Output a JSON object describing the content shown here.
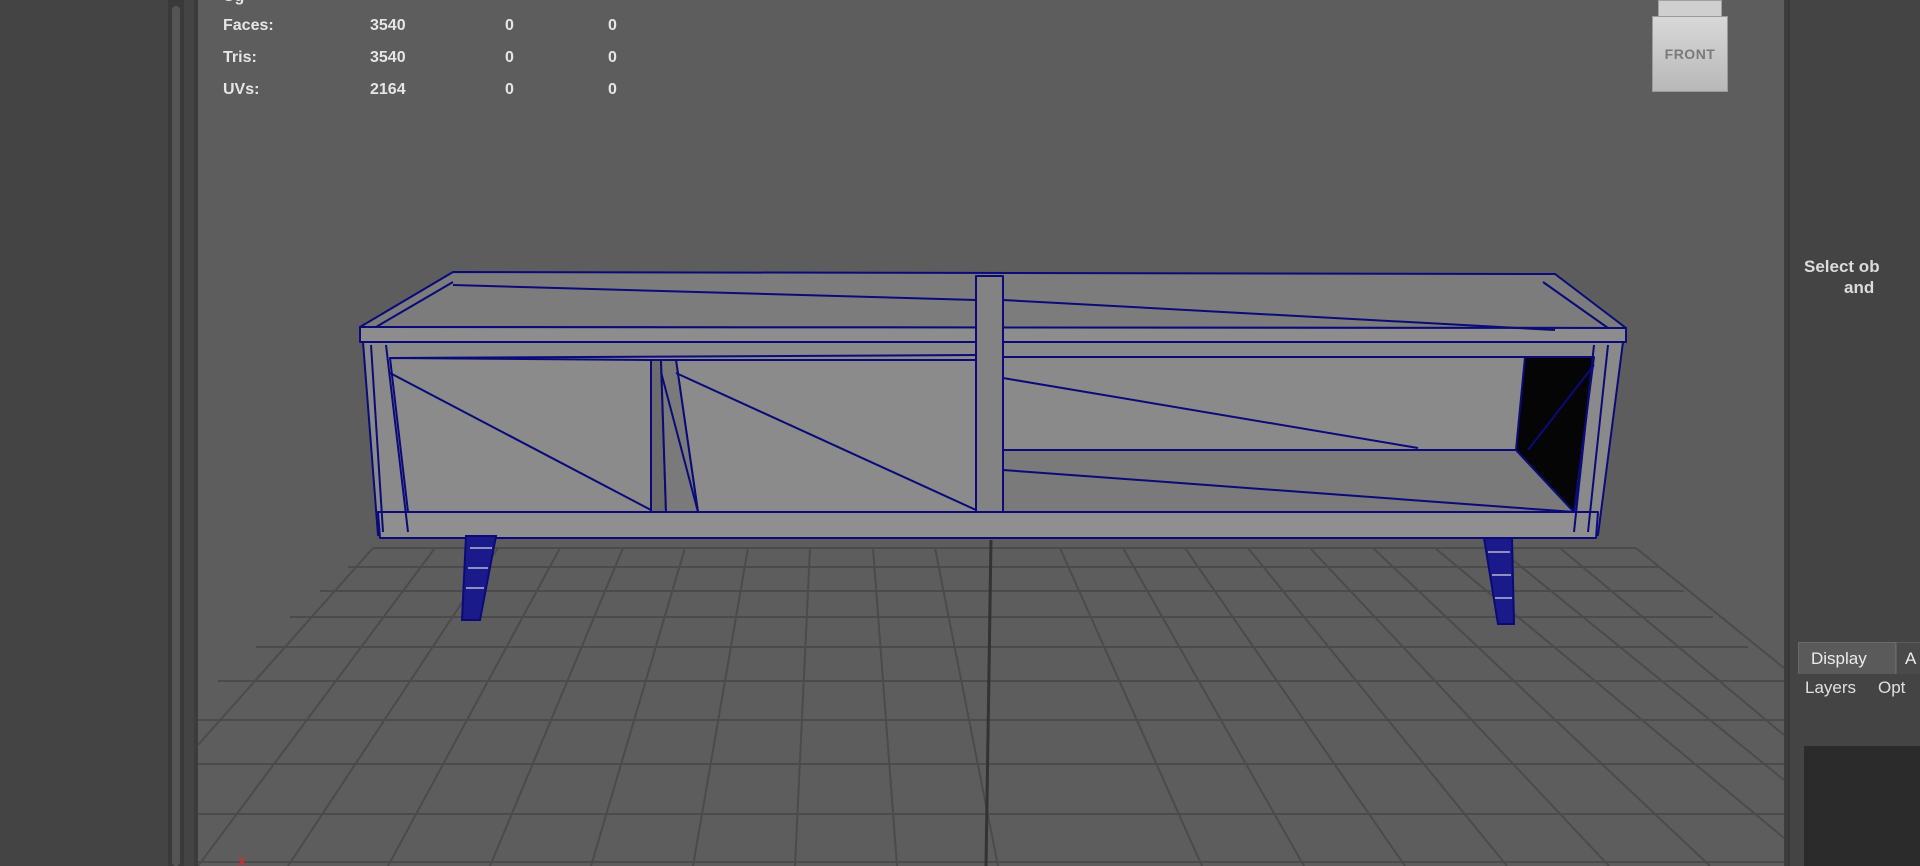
{
  "hud": {
    "partial_label": "Ug",
    "rows": [
      {
        "label": "Faces:",
        "v1": "3540",
        "v2": "0",
        "v3": "0"
      },
      {
        "label": "Tris:",
        "v1": "3540",
        "v2": "0",
        "v3": "0"
      },
      {
        "label": "UVs:",
        "v1": "2164",
        "v2": "0",
        "v3": "0"
      }
    ]
  },
  "viewcube": {
    "face_label": "FRONT"
  },
  "axis_indicator": {
    "label": "x"
  },
  "attribute_editor": {
    "hint_line1": "Select ob",
    "hint_line2": "and"
  },
  "layer_editor": {
    "tab_display": "Display",
    "tab_anim": "A",
    "menu_layers": "Layers",
    "menu_options": "Opt"
  },
  "colors": {
    "viewport_bg": "#5d5d5d",
    "wireframe": "#0a0a78",
    "grid": "#4a4a4a",
    "panel_bg": "#444444"
  }
}
